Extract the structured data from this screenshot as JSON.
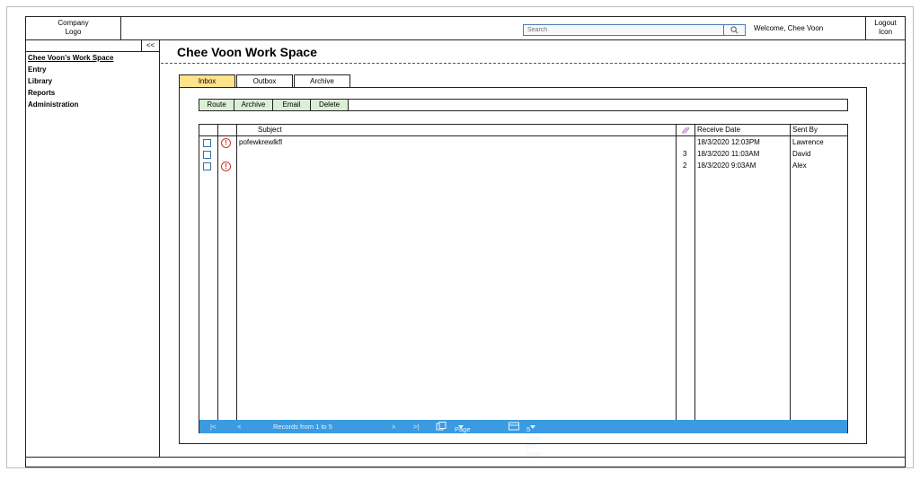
{
  "header": {
    "logo_line1": "Company",
    "logo_line2": "Logo",
    "search_placeholder": "Search",
    "welcome": "Welcome, Chee Voon",
    "logout_line1": "Logout",
    "logout_line2": "Icon"
  },
  "sidebar": {
    "collapse_label": "<<",
    "items": [
      {
        "label": "Chee Voon's Work Space"
      },
      {
        "label": "Entry"
      },
      {
        "label": "Library"
      },
      {
        "label": "Reports"
      },
      {
        "label": "Administration"
      }
    ]
  },
  "main": {
    "title": "Chee Voon Work Space",
    "tabs": [
      {
        "label": "Inbox"
      },
      {
        "label": "Outbox"
      },
      {
        "label": "Archive"
      }
    ],
    "toolbar": {
      "route": "Route",
      "archive": "Archive",
      "email": "Email",
      "delete": "Delete"
    },
    "columns": {
      "subject": "Subject",
      "receive_date": "Receive Date",
      "sent_by": "Sent By"
    },
    "rows": [
      {
        "subject": "pofewkrewlkfl",
        "attachments": "",
        "receive_date": "18/3/2020 12:03PM",
        "sent_by": "Lawrence"
      },
      {
        "subject": "",
        "attachments": "3",
        "receive_date": "18/3/2020 11:03AM",
        "sent_by": "David"
      },
      {
        "subject": "",
        "attachments": "2",
        "receive_date": "18/3/2020 9:03AM",
        "sent_by": "Alex"
      }
    ],
    "pager": {
      "first": "|<",
      "prev": "<",
      "records": "Records from 1 to 5",
      "next": ">",
      "last": ">|",
      "page": "Page 1",
      "rows_per_page": "5 rows per page"
    }
  },
  "colors": {
    "active_tab": "#ffe38a",
    "toolbar_button": "#dcefd6",
    "pager_bar": "#3b9be0",
    "alert": "#d0331f",
    "checkbox": "#3a6ea8"
  }
}
